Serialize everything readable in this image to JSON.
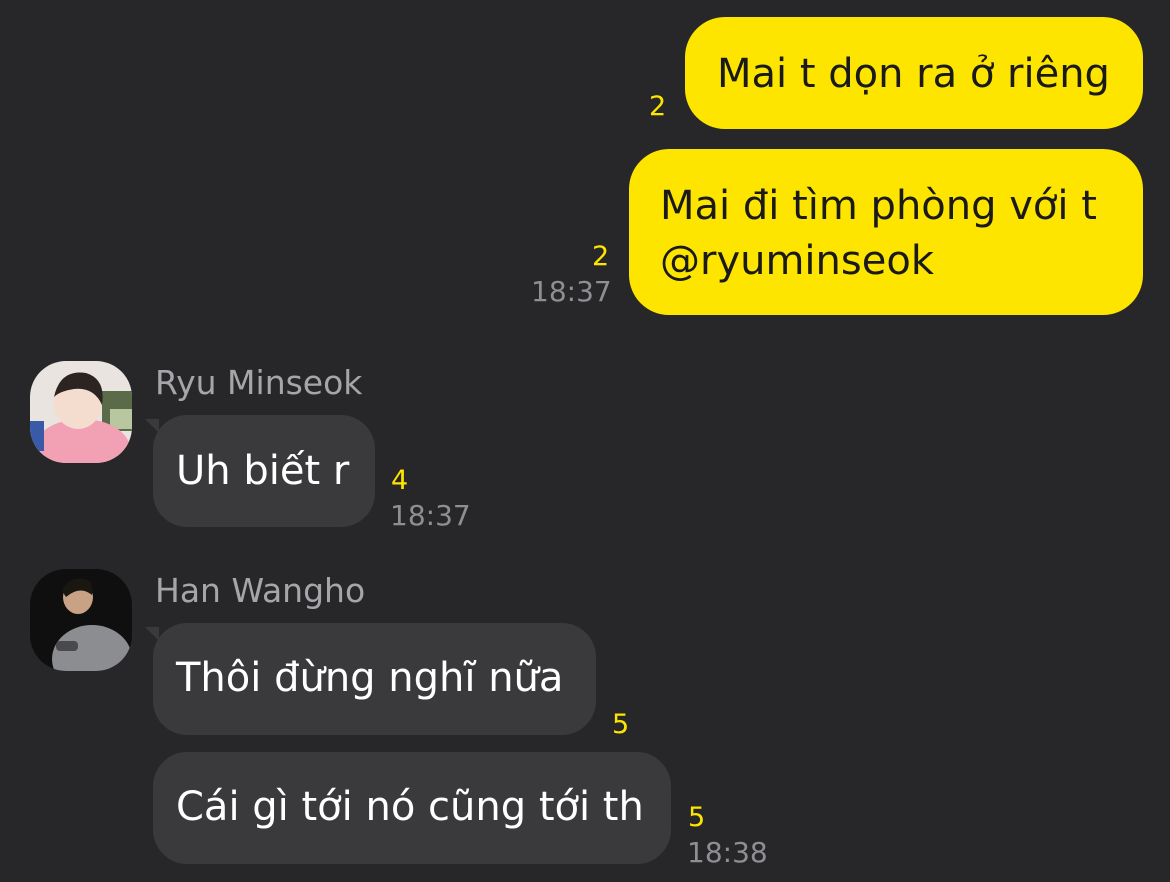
{
  "messages_out": [
    {
      "text": "Mai t dọn ra ở riêng",
      "unread": "2"
    },
    {
      "line1": "Mai đi tìm phòng với t",
      "line2": "@ryuminseok",
      "unread": "2",
      "time": "18:37"
    }
  ],
  "ryu": {
    "name": "Ryu Minseok",
    "message": "Uh biết r",
    "unread": "4",
    "time": "18:37"
  },
  "han": {
    "name": "Han Wangho",
    "messages": [
      {
        "text": "Thôi đừng nghĩ nữa",
        "unread": "5"
      },
      {
        "text": "Cái gì tới nó cũng tới th",
        "unread": "5",
        "time": "18:38"
      }
    ]
  },
  "colors": {
    "background": "#272729",
    "outgoing_bubble": "#FEE500",
    "incoming_bubble": "#3a3a3c",
    "unread_count": "#FEE500",
    "timestamp": "#8e8e93"
  }
}
